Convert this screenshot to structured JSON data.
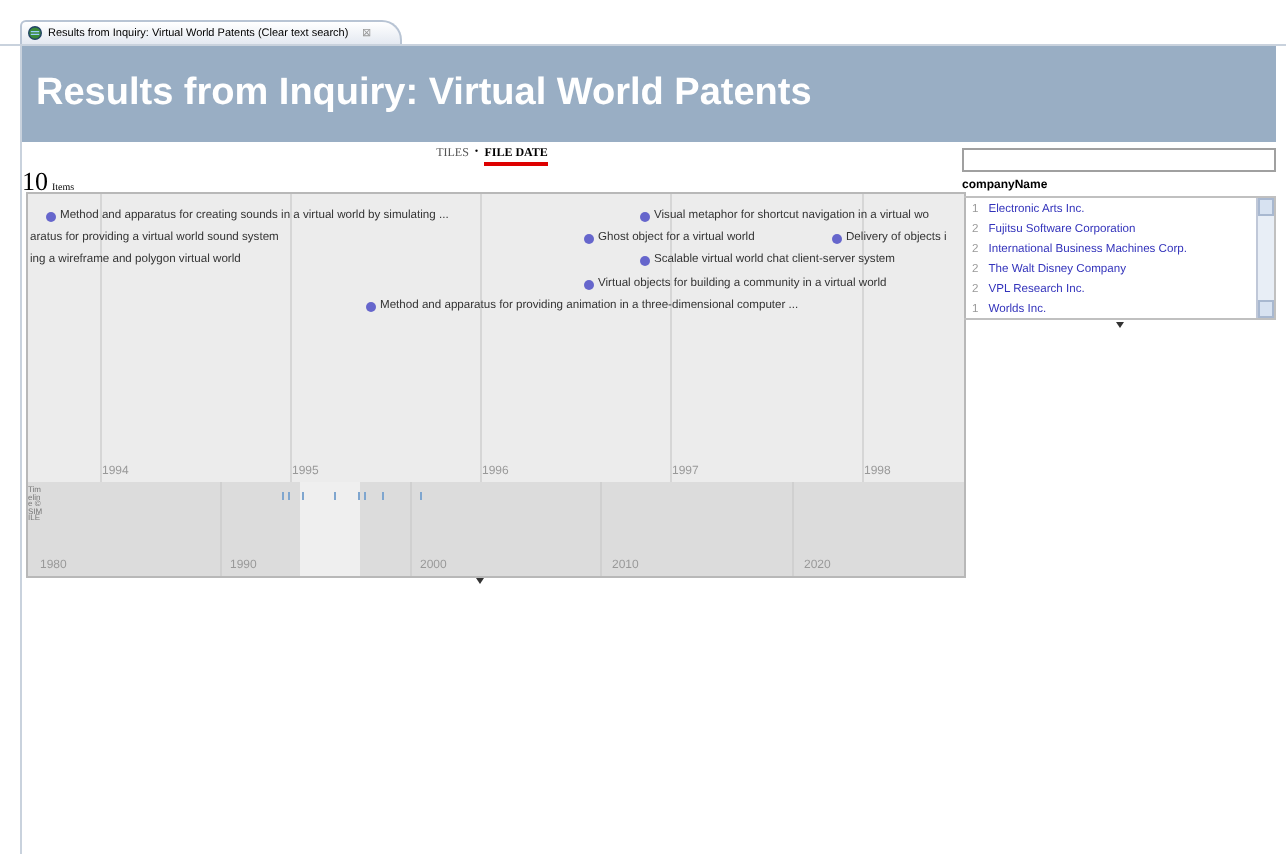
{
  "tab": {
    "title": "Results from Inquiry: Virtual World Patents (Clear text search)",
    "close": "⊠"
  },
  "header": {
    "title": "Results from Inquiry: Virtual World Patents"
  },
  "views": [
    {
      "label": "TILES",
      "selected": false
    },
    {
      "label": "FILE DATE",
      "selected": true
    }
  ],
  "view_separator": "•",
  "item_count": {
    "number": "10",
    "label": "Items"
  },
  "timeline": {
    "events": [
      {
        "title": "Method and apparatus for creating sounds in a virtual world by simulating ...",
        "dot": true
      },
      {
        "title": "Visual metaphor for shortcut navigation in a virtual wo",
        "dot": true
      },
      {
        "title": "aratus for providing a virtual world sound system",
        "dot": false
      },
      {
        "title": "Ghost object for a virtual world",
        "dot": true
      },
      {
        "title": "Delivery of objects i",
        "dot": true
      },
      {
        "title": "ing a wireframe and polygon virtual world",
        "dot": false
      },
      {
        "title": "Scalable virtual world chat client-server system",
        "dot": true
      },
      {
        "title": "Virtual objects for building a community in a virtual world",
        "dot": true
      },
      {
        "title": "Method and apparatus for providing animation in a three-dimensional computer ...",
        "dot": true
      }
    ],
    "years": [
      "1994",
      "1995",
      "1996",
      "1997",
      "1998"
    ],
    "overview_years": [
      "1980",
      "1990",
      "2000",
      "2010",
      "2020"
    ],
    "credit": "Timeline © SIMILE"
  },
  "facet": {
    "title": "companyName",
    "items": [
      {
        "count": "1",
        "name": "Electronic Arts  Inc."
      },
      {
        "count": "2",
        "name": "Fujitsu Software Corporation"
      },
      {
        "count": "2",
        "name": "International Business Machines Corp."
      },
      {
        "count": "2",
        "name": "The Walt Disney Company"
      },
      {
        "count": "2",
        "name": "VPL Research  Inc."
      },
      {
        "count": "1",
        "name": "Worlds  Inc."
      }
    ]
  }
}
